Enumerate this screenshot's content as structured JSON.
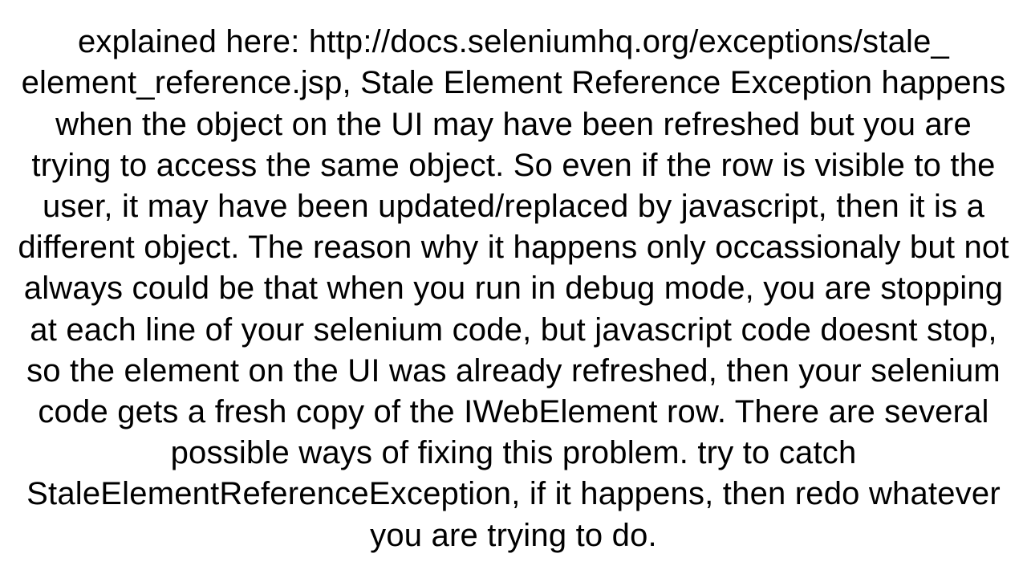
{
  "paragraph": {
    "text": "explained here: http://docs.seleniumhq.org/exceptions/stale_​element_reference.jsp, Stale Element Reference Exception happens when the object on the UI may have been refreshed but you are trying to access the same object. So even if the row is visible to the user, it may have been updated/replaced by javascript, then it is a different object.  The reason why it happens only occassionaly but not always could be that when you run in debug mode, you are stopping at each line of your selenium code, but javascript code doesnt stop, so the element on the UI was already refreshed, then your selenium code gets a fresh copy of the IWebElement row.  There are several possible ways of fixing this problem.   try to catch StaleElementReferenceException, if it happens, then redo whatever you are trying to do."
  }
}
